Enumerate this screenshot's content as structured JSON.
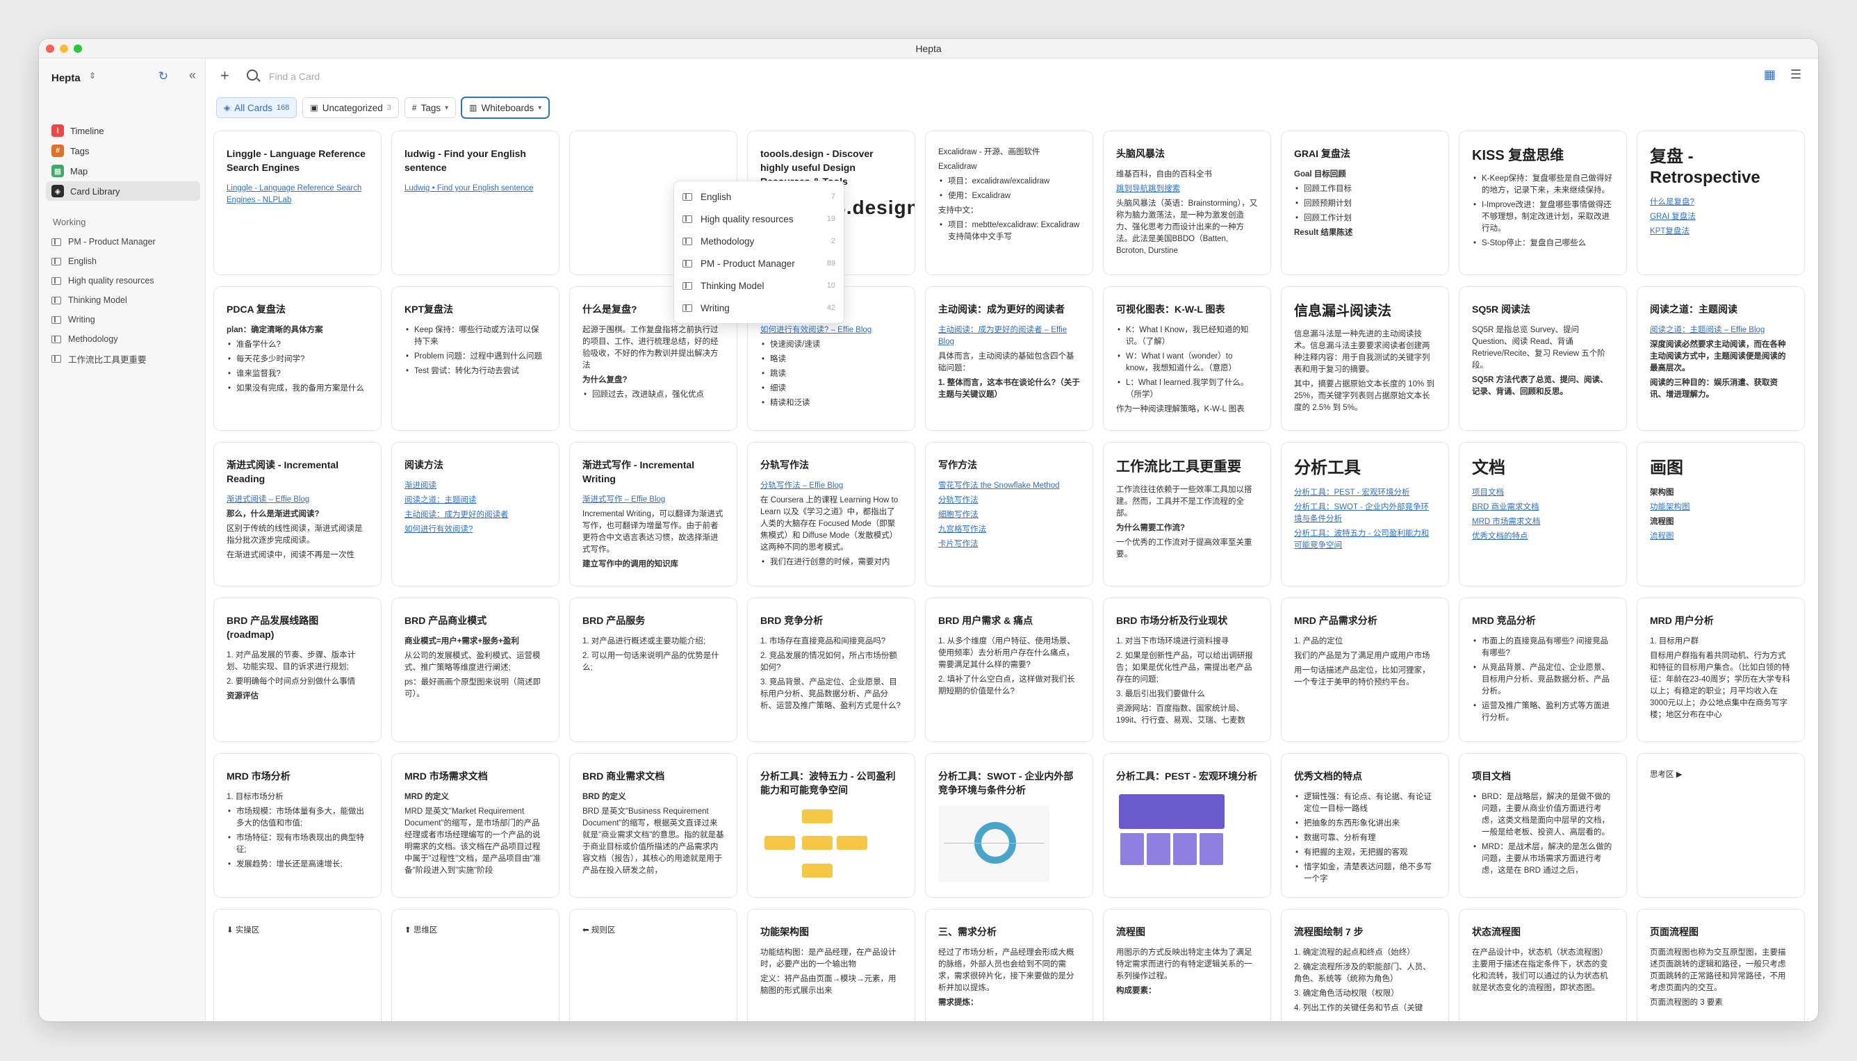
{
  "window_title": "Hepta",
  "sidebar": {
    "workspace": "Hepta",
    "nav": [
      {
        "label": "Timeline",
        "icon": "timeline-icon",
        "color": "#e8484a",
        "glyph": "⌇"
      },
      {
        "label": "Tags",
        "icon": "tags-icon",
        "color": "#e0712b",
        "glyph": "#"
      },
      {
        "label": "Map",
        "icon": "map-icon",
        "color": "#3fa866",
        "glyph": "▦"
      },
      {
        "label": "Card Library",
        "icon": "card-library-icon",
        "color": "#2b2b2b",
        "glyph": "◈"
      }
    ],
    "section_title": "Working",
    "whiteboards": [
      "PM - Product Manager",
      "English",
      "High quality resources",
      "Thinking Model",
      "Writing",
      "Methodology",
      "工作流比工具更重要"
    ]
  },
  "toolbar": {
    "search_placeholder": "Find a Card"
  },
  "filters": {
    "all_cards": "All Cards",
    "all_count": "168",
    "uncategorized": "Uncategorized",
    "uncategorized_count": "3",
    "tags": "Tags",
    "whiteboards": "Whiteboards"
  },
  "whiteboard_menu": [
    {
      "label": "English",
      "count": "7"
    },
    {
      "label": "High quality resources",
      "count": "19"
    },
    {
      "label": "Methodology",
      "count": "2"
    },
    {
      "label": "PM - Product Manager",
      "count": "89"
    },
    {
      "label": "Thinking Model",
      "count": "10"
    },
    {
      "label": "Writing",
      "count": "42"
    }
  ],
  "cards": [
    [
      {
        "title": "Linggle - Language Reference Search Engines",
        "lines": [
          {
            "t": "Linggle - Language Reference Search Engines - NLPLab",
            "k": "link"
          }
        ]
      },
      {
        "title": "ludwig - Find your English sentence",
        "lines": [
          {
            "t": "Ludwig • Find your English sentence",
            "k": "link"
          }
        ]
      },
      {
        "title": "",
        "lines": []
      },
      {
        "title": "toools.design - Discover highly useful Design Resources & Tools",
        "logo": "TOOOLS.design",
        "lines": []
      },
      {
        "title": "",
        "lines": [
          {
            "t": "Excalidraw - 开源、画图软件",
            "k": ""
          },
          {
            "t": "Excalidraw",
            "k": ""
          },
          {
            "t": "项目：excalidraw/excalidraw",
            "k": "bullet"
          },
          {
            "t": "使用：Excalidraw",
            "k": "bullet"
          },
          {
            "t": "支持中文：",
            "k": ""
          },
          {
            "t": "项目：mebtte/excalidraw: Excalidraw 支持简体中文手写",
            "k": "bullet"
          }
        ]
      },
      {
        "title": "头脑风暴法",
        "lines": [
          {
            "t": "维基百科，自由的百科全书",
            "k": ""
          },
          {
            "t": "跳到导航跳到搜索",
            "k": "link"
          },
          {
            "t": "头脑风暴法（英语：Brainstorming），又称为脑力激荡法，是一种为激发创造力、强化思考力而设计出来的一种方法。此法是美国BBDO（Batten, Bcroton, Durstine",
            "k": ""
          }
        ]
      },
      {
        "title": "GRAI 复盘法",
        "lines": [
          {
            "t": "Goal 目标回顾",
            "k": "bold"
          },
          {
            "t": "回顾工作目标",
            "k": "bullet"
          },
          {
            "t": "回顾预期计划",
            "k": "bullet"
          },
          {
            "t": "回顾工作计划",
            "k": "bullet"
          },
          {
            "t": "Result 结果陈述",
            "k": "bold"
          }
        ]
      },
      {
        "title": "KISS 复盘思维",
        "size": "mid",
        "lines": [
          {
            "t": "K-Keep保持：复盘哪些是自己做得好的地方，记录下来，未来继续保持。",
            "k": "bullet"
          },
          {
            "t": "I-Improve改进：复盘哪些事情做得还不够理想，制定改进计划，采取改进行动。",
            "k": "bullet"
          },
          {
            "t": "S-Stop停止：复盘自己哪些么",
            "k": "bullet"
          }
        ]
      },
      {
        "title": "复盘 - Retrospective",
        "size": "big",
        "lines": [
          {
            "t": "什么是复盘?",
            "k": "link"
          },
          {
            "t": "GRAI 复盘法",
            "k": "link"
          },
          {
            "t": "KPT复盘法",
            "k": "link"
          }
        ]
      }
    ],
    [
      {
        "title": "PDCA 复盘法",
        "lines": [
          {
            "t": "plan：确定清晰的具体方案",
            "k": "bold"
          },
          {
            "t": "准备学什么?",
            "k": "bullet"
          },
          {
            "t": "每天花多少时间学?",
            "k": "bullet"
          },
          {
            "t": "谁来监督我?",
            "k": "bullet"
          },
          {
            "t": "如果没有完成，我的备用方案是什么",
            "k": "bullet"
          }
        ]
      },
      {
        "title": "KPT复盘法",
        "lines": [
          {
            "t": "Keep 保持：哪些行动或方法可以保持下来",
            "k": "bullet"
          },
          {
            "t": "Problem 问题：过程中遇到什么问题",
            "k": "bullet"
          },
          {
            "t": "Test 尝试：转化为行动去尝试",
            "k": "bullet"
          }
        ]
      },
      {
        "title": "什么是复盘?",
        "lines": [
          {
            "t": "起源于围棋。工作复盘指将之前执行过的项目、工作、进行梳理总结，好的经验吸收，不好的作为教训并提出解决方法",
            "k": ""
          },
          {
            "t": "为什么复盘?",
            "k": "bold"
          },
          {
            "t": "回顾过去，改进缺点，强化优点",
            "k": "bullet"
          }
        ]
      },
      {
        "title": "如何进行有效阅读?",
        "lines": [
          {
            "t": "如何进行有效阅读? – Effie Blog",
            "k": "link"
          },
          {
            "t": "快速阅读/速读",
            "k": "bullet"
          },
          {
            "t": "略读",
            "k": "bullet"
          },
          {
            "t": "跳读",
            "k": "bullet"
          },
          {
            "t": "细读",
            "k": "bullet"
          },
          {
            "t": "精读和泛读",
            "k": "bullet"
          }
        ]
      },
      {
        "title": "主动阅读：成为更好的阅读者",
        "lines": [
          {
            "t": "主动阅读：成为更好的阅读者 – Effie Blog",
            "k": "link"
          },
          {
            "t": "具体而言，主动阅读的基础包含四个基础问题：",
            "k": ""
          },
          {
            "t": "1. 整体而言，这本书在谈论什么?（关于主题与关键议题）",
            "k": "bold"
          }
        ]
      },
      {
        "title": "可视化图表：K-W-L 图表",
        "lines": [
          {
            "t": "K：What I Know，我已经知道的知识。（了解）",
            "k": "bullet"
          },
          {
            "t": "W：What I want（wonder）to know，我想知道什么。（意愿）",
            "k": "bullet"
          },
          {
            "t": "L：What I learned.我学到了什么。（所学）",
            "k": "bullet"
          },
          {
            "t": "作为一种阅读理解策略，K-W-L 图表",
            "k": ""
          }
        ]
      },
      {
        "title": "信息漏斗阅读法",
        "size": "mid",
        "lines": [
          {
            "t": "信息漏斗法是一种先进的主动阅读技术。信息漏斗法主要要求阅读者创建两种注释内容：用于自我测试的关键字列表和用于复习的摘要。",
            "k": ""
          },
          {
            "t": "其中，摘要占据原始文本长度的 10% 到 25%，而关键字列表则占据原始文本长度的 2.5% 到 5%。",
            "k": ""
          }
        ]
      },
      {
        "title": "SQ5R 阅读法",
        "lines": [
          {
            "t": "SQ5R 是指总览 Survey、提问 Question、阅读 Read、背诵 Retrieve/Recite、复习 Review 五个阶段。",
            "k": ""
          },
          {
            "t": "SQ5R 方法代表了总览、提问、阅读、记录、背诵、回顾和反思。",
            "k": "bold"
          }
        ]
      },
      {
        "title": "阅读之道：主题阅读",
        "lines": [
          {
            "t": "阅读之道：主题阅读 – Effie Blog",
            "k": "link"
          },
          {
            "t": "深度阅读必然要求主动阅读，而在各种主动阅读方式中，主题阅读便是阅读的最高层次。",
            "k": "bold"
          },
          {
            "t": "阅读的三种目的：娱乐消遣、获取资讯、增进理解力。",
            "k": "bold"
          }
        ]
      }
    ],
    [
      {
        "title": "渐进式阅读 - Incremental Reading",
        "lines": [
          {
            "t": "渐进式阅读 – Effie Blog",
            "k": "link"
          },
          {
            "t": "那么，什么是渐进式阅读?",
            "k": "bold"
          },
          {
            "t": "区别于传统的线性阅读，渐进式阅读是指分批次逐步完成阅读。",
            "k": ""
          },
          {
            "t": "在渐进式阅读中，阅读不再是一次性",
            "k": ""
          }
        ]
      },
      {
        "title": "阅读方法",
        "lines": [
          {
            "t": "渐进阅读",
            "k": "link"
          },
          {
            "t": "阅读之道：主题阅读",
            "k": "link"
          },
          {
            "t": "主动阅读：成为更好的阅读者",
            "k": "link"
          },
          {
            "t": "如何进行有效阅读?",
            "k": "link"
          }
        ]
      },
      {
        "title": "渐进式写作 - Incremental Writing",
        "lines": [
          {
            "t": "渐进式写作 – Effie Blog",
            "k": "link"
          },
          {
            "t": "Incremental Writing，可以翻译为渐进式写作，也可翻译为增量写作。由于前者更符合中文语言表达习惯，故选择渐进式写作。",
            "k": ""
          },
          {
            "t": "建立写作中的调用的知识库",
            "k": "bold"
          }
        ]
      },
      {
        "title": "分轨写作法",
        "lines": [
          {
            "t": "分轨写作法 – Effie Blog",
            "k": "link"
          },
          {
            "t": "在 Coursera 上的课程 Learning How to Learn 以及《学习之道》中，都指出了人类的大脑存在 Focused Mode（即聚焦模式）和 Diffuse Mode（发散模式）这两种不同的思考模式。",
            "k": ""
          },
          {
            "t": "我们在进行创意的时候，需要对内",
            "k": "bullet"
          }
        ]
      },
      {
        "title": "写作方法",
        "lines": [
          {
            "t": "雪花写作法 the Snowflake Method",
            "k": "link"
          },
          {
            "t": "分轨写作法",
            "k": "link"
          },
          {
            "t": "细胞写作法",
            "k": "link"
          },
          {
            "t": "九宫格写作法",
            "k": "link"
          },
          {
            "t": "卡片写作法",
            "k": "link"
          }
        ]
      },
      {
        "title": "工作流比工具更重要",
        "size": "mid",
        "lines": [
          {
            "t": "工作流往往依赖于一些效率工具加以搭建。然而，工具并不是工作流程的全部。",
            "k": ""
          },
          {
            "t": "为什么需要工作流?",
            "k": "bold"
          },
          {
            "t": "一个优秀的工作流对于提高效率至关重要。",
            "k": ""
          }
        ]
      },
      {
        "title": "分析工具",
        "size": "big",
        "lines": [
          {
            "t": "分析工具：PEST - 宏观环境分析",
            "k": "link"
          },
          {
            "t": "分析工具：SWOT - 企业内外部竞争环境与条件分析",
            "k": "link"
          },
          {
            "t": "分析工具：波特五力 - 公司盈利能力和可能竞争空间",
            "k": "link"
          }
        ]
      },
      {
        "title": "文档",
        "size": "big",
        "lines": [
          {
            "t": "项目文档",
            "k": "link"
          },
          {
            "t": "BRD 商业需求文档",
            "k": "link"
          },
          {
            "t": "MRD 市场需求文档",
            "k": "link"
          },
          {
            "t": "优秀文档的特点",
            "k": "link"
          }
        ]
      },
      {
        "title": "画图",
        "size": "big",
        "lines": [
          {
            "t": "架构图",
            "k": "bold"
          },
          {
            "t": "功能架构图",
            "k": "link"
          },
          {
            "t": "流程图",
            "k": "bold"
          },
          {
            "t": "流程图",
            "k": "link"
          }
        ]
      }
    ],
    [
      {
        "title": "BRD 产品发展线路图 (roadmap)",
        "lines": [
          {
            "t": "1. 对产品发展的节奏、步骤、版本计划、功能实现、目的诉求进行规划;",
            "k": ""
          },
          {
            "t": "2. 要明确每个时间点分别做什么事情",
            "k": ""
          },
          {
            "t": "资源评估",
            "k": "bold"
          }
        ]
      },
      {
        "title": "BRD 产品商业模式",
        "lines": [
          {
            "t": "商业模式=用户+需求+服务+盈利",
            "k": "bold"
          },
          {
            "t": "从公司的发展模式、盈利模式、运营模式、推广策略等维度进行阐述;",
            "k": ""
          },
          {
            "t": "ps：最好画画个原型图来说明（简述即可）。",
            "k": ""
          }
        ]
      },
      {
        "title": "BRD 产品服务",
        "lines": [
          {
            "t": "1. 对产品进行概述或主要功能介绍;",
            "k": ""
          },
          {
            "t": "2. 可以用一句话来说明产品的优势是什么;",
            "k": ""
          }
        ]
      },
      {
        "title": "BRD 竞争分析",
        "lines": [
          {
            "t": "1. 市场存在直接竞品和间接竞品吗?",
            "k": ""
          },
          {
            "t": "2. 竞品发展的情况如何，所占市场份额如何?",
            "k": ""
          },
          {
            "t": "3. 竞品背景、产品定位、企业愿景、目标用户分析、竞品数据分析、产品分析、运营及推广策略、盈利方式是什么?",
            "k": ""
          }
        ]
      },
      {
        "title": "BRD 用户需求 & 痛点",
        "lines": [
          {
            "t": "1. 从多个维度（用户特征、使用场景、使用频率）去分析用户存在什么痛点，需要满足其什么样的需要?",
            "k": ""
          },
          {
            "t": "2. 填补了什么空白点，这样做对我们长期短期的价值是什么?",
            "k": ""
          }
        ]
      },
      {
        "title": "BRD 市场分析及行业现状",
        "lines": [
          {
            "t": "1. 对当下市场环境进行资料搜寻",
            "k": ""
          },
          {
            "t": "2. 如果是创新性产品，可以给出调研报告；如果是优化性产品，需提出老产品存在的问题;",
            "k": ""
          },
          {
            "t": "3. 最后引出我们要做什么",
            "k": ""
          },
          {
            "t": "资源网站：百度指数、国家统计局、199it、行行查、易观、艾瑞、七麦数",
            "k": ""
          }
        ]
      },
      {
        "title": "MRD 产品需求分析",
        "lines": [
          {
            "t": "1. 产品的定位",
            "k": ""
          },
          {
            "t": "我们的产品是为了满足用户或用户市场",
            "k": ""
          },
          {
            "t": "用一句话描述产品定位，比如河狸家，一个专注于美甲的特价预约平台。",
            "k": ""
          }
        ]
      },
      {
        "title": "MRD 竞品分析",
        "lines": [
          {
            "t": "市面上的直接竞品有哪些? 间接竞品有哪些?",
            "k": "bullet"
          },
          {
            "t": "从竞品背景、产品定位、企业愿景、目标用户分析、竞品数据分析、产品分析。",
            "k": "bullet"
          },
          {
            "t": "运营及推广策略、盈利方式等方面进行分析。",
            "k": "bullet"
          }
        ]
      },
      {
        "title": "MRD 用户分析",
        "lines": [
          {
            "t": "1. 目标用户群",
            "k": ""
          },
          {
            "t": "目标用户群指有着共同动机、行为方式和特征的目标用户集合。（比如白领的特征：年龄在23-40周岁；学历在大学专科以上；有稳定的职业；月平均收入在3000元以上；办公地点集中在商务写字楼；地区分布在中心",
            "k": ""
          }
        ]
      }
    ],
    [
      {
        "title": "MRD 市场分析",
        "lines": [
          {
            "t": "1. 目标市场分析",
            "k": ""
          },
          {
            "t": "市场规模：市场体量有多大，能做出多大的估值和市值;",
            "k": "bullet"
          },
          {
            "t": "市场特征：现有市场表现出的典型特征;",
            "k": "bullet"
          },
          {
            "t": "发展趋势：增长还是高速增长;",
            "k": "bullet"
          }
        ]
      },
      {
        "title": "MRD 市场需求文档",
        "lines": [
          {
            "t": "MRD 的定义",
            "k": "bold"
          },
          {
            "t": "MRD 是英文\"Market Requirement Document\"的缩写，是市场部门的产品经理或者市场经理编写的一个产品的说明需求的文档。该文档在产品项目过程中属于\"过程性\"文档，是产品项目由\"准备\"阶段进入到\"实施\"阶段",
            "k": ""
          }
        ]
      },
      {
        "title": "BRD 商业需求文档",
        "lines": [
          {
            "t": "BRD 的定义",
            "k": "bold"
          },
          {
            "t": "BRD 是英文\"Business Requirement Document\"的缩写，根据英文直译过来就是\"商业需求文档\"的意思。指的就是基于商业目标或价值所描述的产品需求内容文档（报告），其核心的用途就是用于产品在投入研发之前，",
            "k": ""
          }
        ]
      },
      {
        "title": "分析工具：波特五力 - 公司盈利能力和可能竞争空间",
        "thumb": "porter",
        "lines": []
      },
      {
        "title": "分析工具：SWOT - 企业内外部竞争环境与条件分析",
        "thumb": "swot",
        "lines": []
      },
      {
        "title": "分析工具：PEST - 宏观环境分析",
        "thumb": "pest",
        "lines": []
      },
      {
        "title": "优秀文档的特点",
        "lines": [
          {
            "t": "逻辑性强：有论点、有论据、有论证 定位一目标一路线",
            "k": "bullet"
          },
          {
            "t": "把抽象的东西形象化讲出来",
            "k": "bullet"
          },
          {
            "t": "数据可靠、分析有理",
            "k": "bullet"
          },
          {
            "t": "有把握的主观，无把握的客观",
            "k": "bullet"
          },
          {
            "t": "惜字如金，清楚表达问题，绝不多写一个字",
            "k": "bullet"
          }
        ]
      },
      {
        "title": "项目文档",
        "lines": [
          {
            "t": "BRD：是战略层，解决的是做不做的问题，主要从商业价值方面进行考虑，这类文档是面向中层早的文档，一般是给老板、投资人、高层看的。",
            "k": "bullet"
          },
          {
            "t": "MRD：是战术层，解决的是怎么做的问题，主要从市场需求方面进行考虑，这是在 BRD 通过之后，",
            "k": "bullet"
          }
        ]
      },
      {
        "title": "",
        "lines": [
          {
            "t": "思考区 ▶",
            "k": ""
          }
        ]
      }
    ],
    [
      {
        "title": "",
        "lines": [
          {
            "t": "⬇ 实操区",
            "k": ""
          }
        ]
      },
      {
        "title": "",
        "lines": [
          {
            "t": "⬆ 思维区",
            "k": ""
          }
        ]
      },
      {
        "title": "",
        "lines": [
          {
            "t": "⬅ 规则区",
            "k": ""
          }
        ]
      },
      {
        "title": "功能架构图",
        "lines": [
          {
            "t": "功能结构图：是产品经理，在产品设计时，必要产出的一个输出物",
            "k": ""
          },
          {
            "t": "定义：将产品由页面→模块→元素，用脑图的形式展示出来",
            "k": ""
          }
        ]
      },
      {
        "title": "三、需求分析",
        "lines": [
          {
            "t": "经过了市场分析，产品经理会形成大概的脉络，外部人员也会给到不同的需求，需求很碎片化，接下来要做的是分析并加以提炼。",
            "k": ""
          },
          {
            "t": "需求提炼：",
            "k": "bold"
          }
        ]
      },
      {
        "title": "流程图",
        "lines": [
          {
            "t": "用图示的方式反映出特定主体为了满足特定需求而进行的有特定逻辑关系的一系列操作过程。",
            "k": ""
          },
          {
            "t": "构成要素：",
            "k": "bold"
          }
        ]
      },
      {
        "title": "流程图绘制 7 步",
        "lines": [
          {
            "t": "1. 确定流程的起点和终点（始终）",
            "k": ""
          },
          {
            "t": "2. 确定流程所涉及的职能部门、人员、角色、系统等（统称为角色）",
            "k": ""
          },
          {
            "t": "3. 确定角色活动权限（权限）",
            "k": ""
          },
          {
            "t": "4. 列出工作的关键任务和节点（关键",
            "k": ""
          }
        ]
      },
      {
        "title": "状态流程图",
        "lines": [
          {
            "t": "在产品设计中，状态机（状态流程图）主要用于描述在指定条件下，状态的变化和流转，我们可以通过的认为状态机就是状态变化的流程图，即状态图。",
            "k": ""
          }
        ]
      },
      {
        "title": "页面流程图",
        "lines": [
          {
            "t": "页面流程图也称为交互原型图，主要描述页面跳转的逻辑和路径，一般只考虑页面跳转的正常路径和异常路径，不用考虑页面内的交互。",
            "k": ""
          },
          {
            "t": "页面流程图的 3 要素",
            "k": ""
          }
        ]
      }
    ]
  ]
}
